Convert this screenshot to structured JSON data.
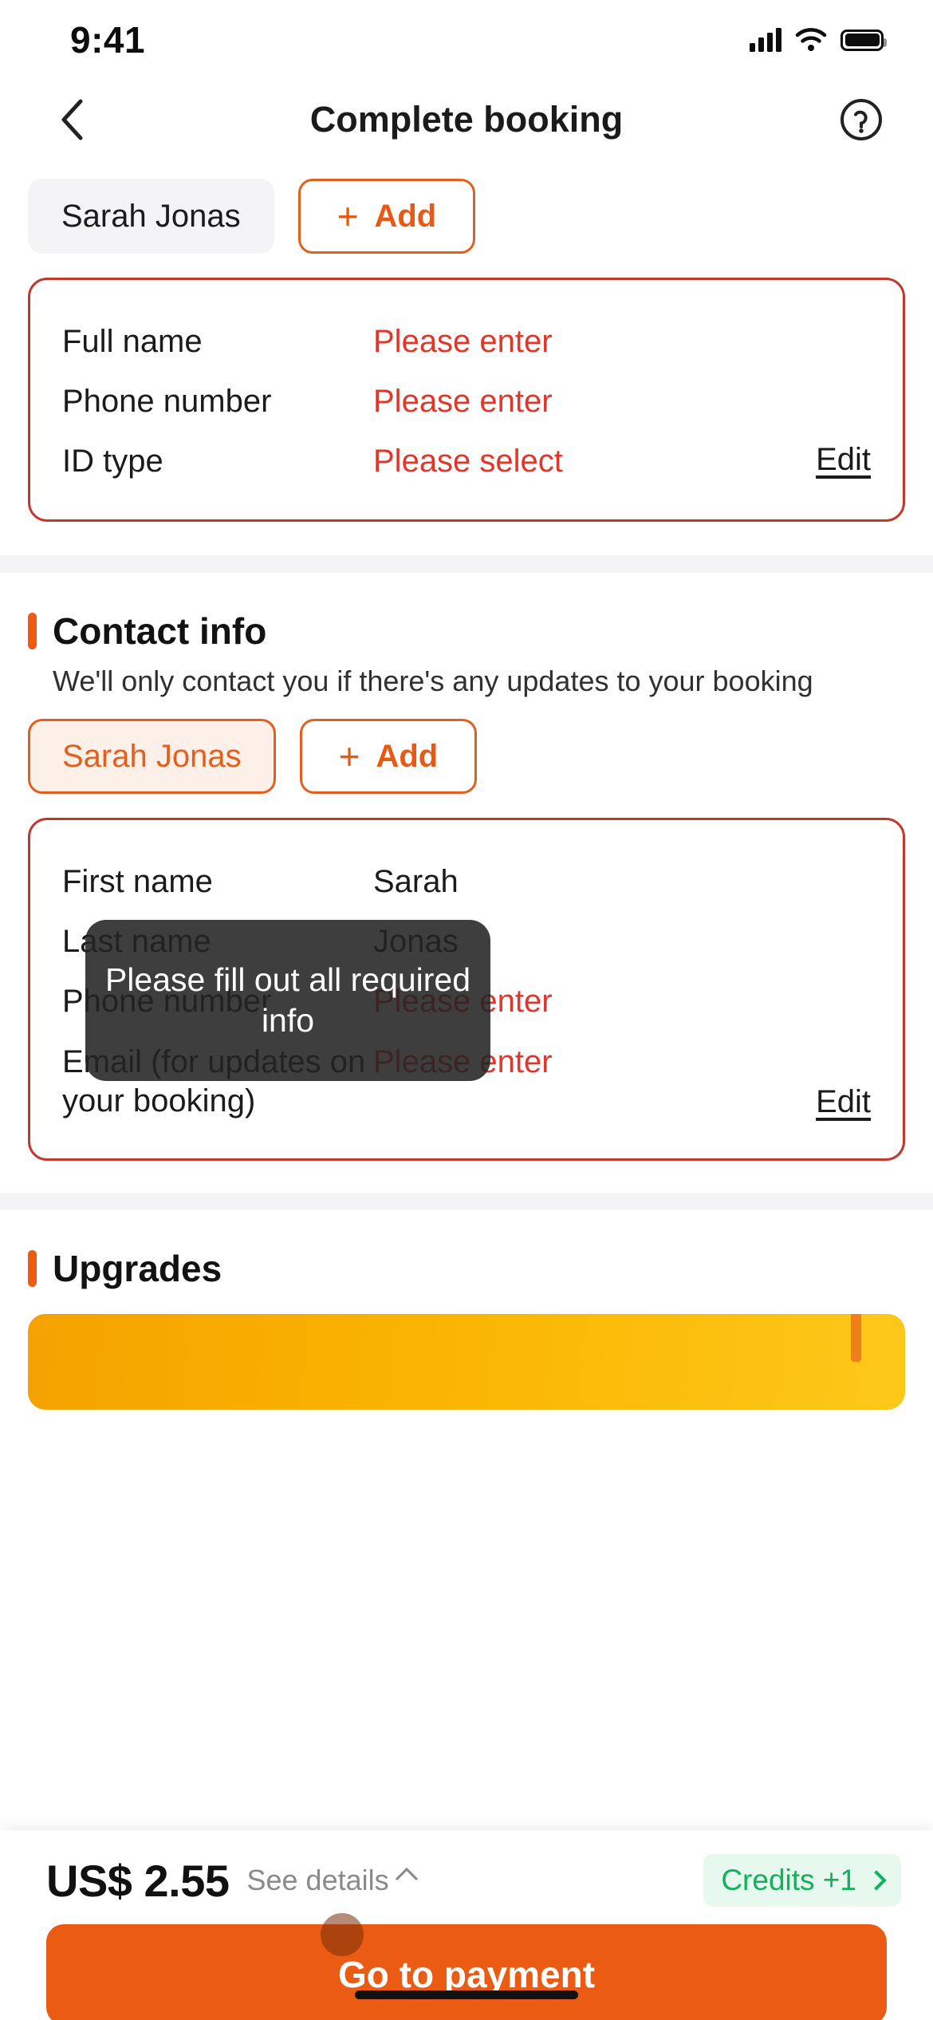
{
  "status_bar": {
    "time": "9:41",
    "cellular_icon": "cellular-signal-icon",
    "wifi_icon": "wifi-icon",
    "battery_icon": "battery-icon"
  },
  "header": {
    "title": "Complete booking",
    "back_icon": "chevron-left-icon",
    "help_icon": "help-circle-icon"
  },
  "passenger_section": {
    "chips": [
      {
        "label": "Sarah Jonas",
        "selected": false
      }
    ],
    "add_label": "Add",
    "add_icon": "plus-icon",
    "card": {
      "rows": [
        {
          "label": "Full name",
          "value": "Please enter",
          "error": true
        },
        {
          "label": "Phone number",
          "value": "Please enter",
          "error": true
        },
        {
          "label": "ID type",
          "value": "Please select",
          "error": true
        }
      ],
      "edit_label": "Edit"
    }
  },
  "contact_section": {
    "title": "Contact info",
    "subtitle": "We'll only contact you if there's any updates to your booking",
    "chips": [
      {
        "label": "Sarah Jonas",
        "selected": true
      }
    ],
    "add_label": "Add",
    "add_icon": "plus-icon",
    "card": {
      "rows": [
        {
          "label": "First name",
          "value": "Sarah",
          "error": false
        },
        {
          "label": "Last name",
          "value": "Jonas",
          "error": false
        },
        {
          "label": "Phone number",
          "value": "Please enter",
          "error": true
        },
        {
          "label": "Email (for updates on your booking)",
          "value": "Please enter",
          "error": true
        }
      ],
      "edit_label": "Edit"
    }
  },
  "upgrades_section": {
    "title": "Upgrades"
  },
  "toast": {
    "message": "Please fill out all required info"
  },
  "bottom_bar": {
    "price": "US$ 2.55",
    "details_label": "See details",
    "details_icon": "chevron-up-icon",
    "credits_label": "Credits +1",
    "credits_icon": "chevron-right-icon",
    "pay_label": "Go to payment"
  },
  "colors": {
    "accent_orange": "#ec5b13",
    "error_red": "#e0372b",
    "card_border_red": "#c0392b",
    "credits_green": "#12b15c",
    "chip_selected_bg": "#fdf0e8"
  }
}
